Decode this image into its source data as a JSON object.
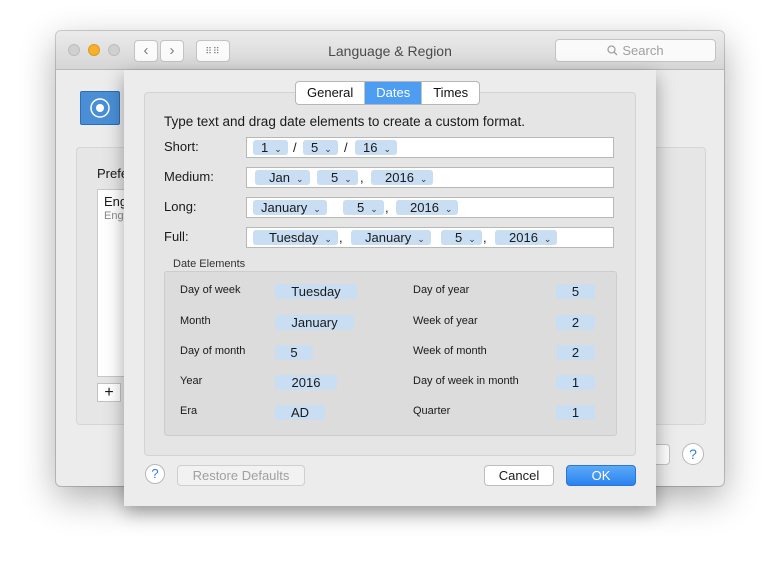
{
  "window": {
    "title": "Language & Region",
    "search_placeholder": "Search",
    "back_icon": "chevron-left-icon",
    "forward_icon": "chevron-right-icon",
    "grid_icon": "grid-icon",
    "preferred_label": "Prefe",
    "list_item_1": "Eng",
    "list_item_2": "Eng",
    "add_label": "+",
    "help_label": "?"
  },
  "sheet": {
    "tabs": [
      "General",
      "Dates",
      "Times"
    ],
    "active_tab": "Dates",
    "instruction": "Type text and drag date elements to create a custom format.",
    "formats": {
      "short": {
        "label": "Short:",
        "tokens": [
          "1",
          "5",
          "16"
        ],
        "sep": [
          "/",
          "/"
        ]
      },
      "medium": {
        "label": "Medium:",
        "tokens": [
          "Jan",
          "5",
          "2016"
        ],
        "sep": [
          "",
          ","
        ]
      },
      "long": {
        "label": "Long:",
        "tokens": [
          "January",
          "5",
          "2016"
        ],
        "sep": [
          "",
          ","
        ]
      },
      "full": {
        "label": "Full:",
        "tokens": [
          "Tuesday",
          "January",
          "5",
          "2016"
        ],
        "sep": [
          ",",
          "",
          ","
        ]
      }
    },
    "elements_title": "Date Elements",
    "elements_left": [
      {
        "label": "Day of week",
        "value": "Tuesday"
      },
      {
        "label": "Month",
        "value": "January"
      },
      {
        "label": "Day of month",
        "value": "5"
      },
      {
        "label": "Year",
        "value": "2016"
      },
      {
        "label": "Era",
        "value": "AD"
      }
    ],
    "elements_right": [
      {
        "label": "Day of year",
        "value": "5"
      },
      {
        "label": "Week of year",
        "value": "2"
      },
      {
        "label": "Week of month",
        "value": "2"
      },
      {
        "label": "Day of week in month",
        "value": "1"
      },
      {
        "label": "Quarter",
        "value": "1"
      }
    ],
    "help_label": "?",
    "restore_label": "Restore Defaults",
    "cancel_label": "Cancel",
    "ok_label": "OK"
  },
  "colors": {
    "accent": "#4d9df2",
    "token": "#c9ddf3",
    "traffic_minimize": "#f5b02c"
  }
}
